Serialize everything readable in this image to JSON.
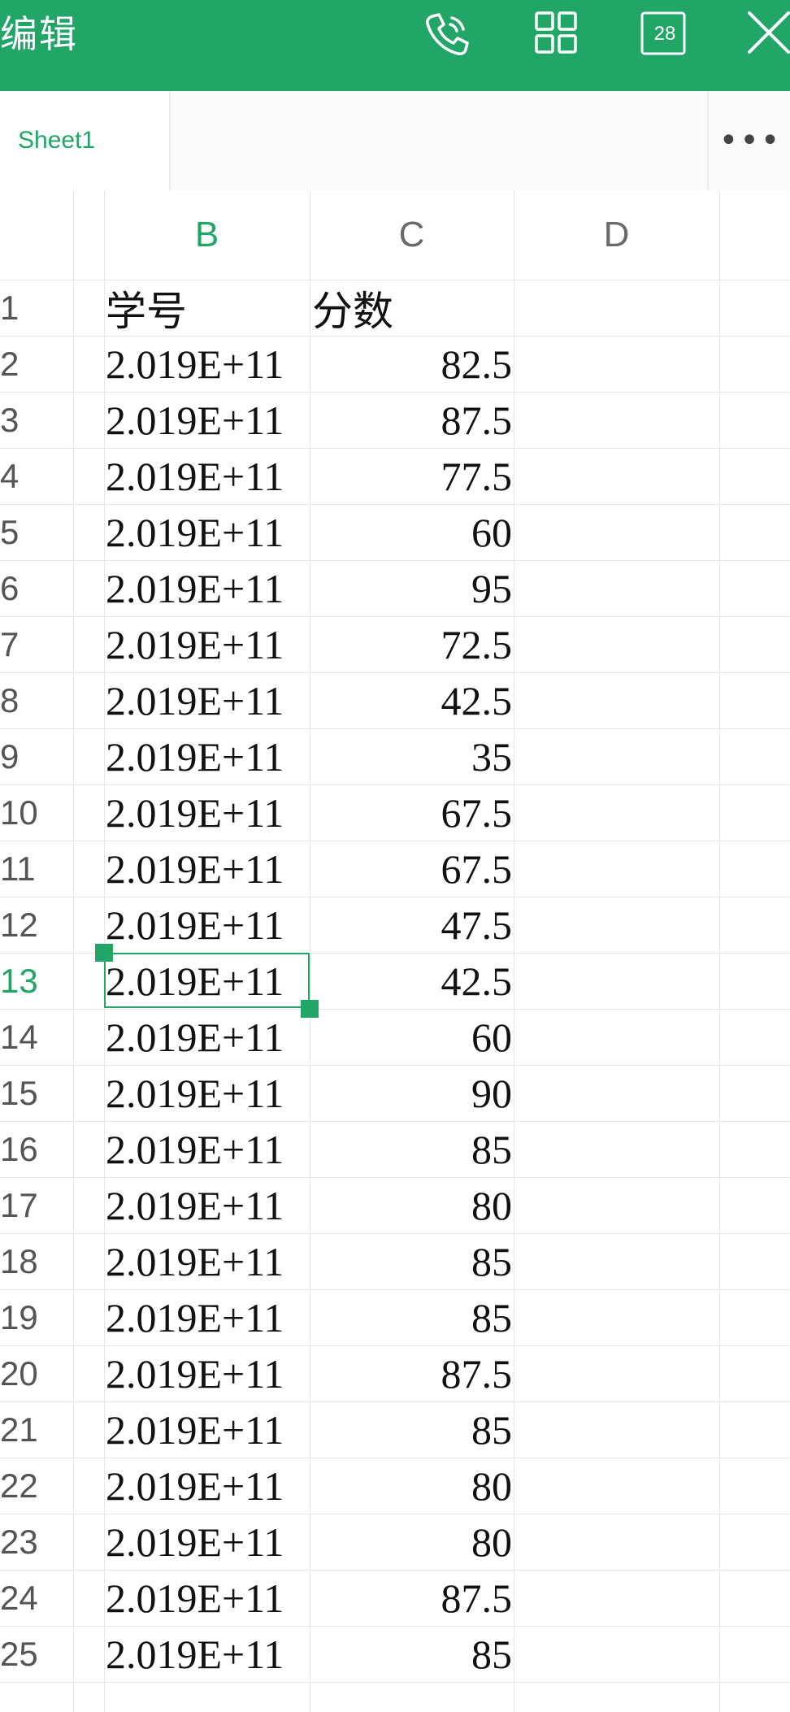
{
  "toolbar": {
    "title": "编辑",
    "icons": [
      "phone-icon",
      "grid-icon",
      "tabs-icon",
      "close-icon"
    ],
    "tab_count": "28",
    "accent_color": "#21a667"
  },
  "sheetbar": {
    "active_sheet": "Sheet1",
    "more_label": "•••"
  },
  "columns": [
    "B",
    "C",
    "D"
  ],
  "active_column": "B",
  "selected_row": "13",
  "rows": [
    {
      "num": "1",
      "b": "学号",
      "c": "分数"
    },
    {
      "num": "2",
      "b": "2.019E+11",
      "c": "82.5"
    },
    {
      "num": "3",
      "b": "2.019E+11",
      "c": "87.5"
    },
    {
      "num": "4",
      "b": "2.019E+11",
      "c": "77.5"
    },
    {
      "num": "5",
      "b": "2.019E+11",
      "c": "60"
    },
    {
      "num": "6",
      "b": "2.019E+11",
      "c": "95"
    },
    {
      "num": "7",
      "b": "2.019E+11",
      "c": "72.5"
    },
    {
      "num": "8",
      "b": "2.019E+11",
      "c": "42.5"
    },
    {
      "num": "9",
      "b": "2.019E+11",
      "c": "35"
    },
    {
      "num": "10",
      "b": "2.019E+11",
      "c": "67.5"
    },
    {
      "num": "11",
      "b": "2.019E+11",
      "c": "67.5"
    },
    {
      "num": "12",
      "b": "2.019E+11",
      "c": "47.5"
    },
    {
      "num": "13",
      "b": "2.019E+11",
      "c": "42.5"
    },
    {
      "num": "14",
      "b": "2.019E+11",
      "c": "60"
    },
    {
      "num": "15",
      "b": "2.019E+11",
      "c": "90"
    },
    {
      "num": "16",
      "b": "2.019E+11",
      "c": "85"
    },
    {
      "num": "17",
      "b": "2.019E+11",
      "c": "80"
    },
    {
      "num": "18",
      "b": "2.019E+11",
      "c": "85"
    },
    {
      "num": "19",
      "b": "2.019E+11",
      "c": "85"
    },
    {
      "num": "20",
      "b": "2.019E+11",
      "c": "87.5"
    },
    {
      "num": "21",
      "b": "2.019E+11",
      "c": "85"
    },
    {
      "num": "22",
      "b": "2.019E+11",
      "c": "80"
    },
    {
      "num": "23",
      "b": "2.019E+11",
      "c": "80"
    },
    {
      "num": "24",
      "b": "2.019E+11",
      "c": "87.5"
    },
    {
      "num": "25",
      "b": "2.019E+11",
      "c": "85"
    }
  ]
}
